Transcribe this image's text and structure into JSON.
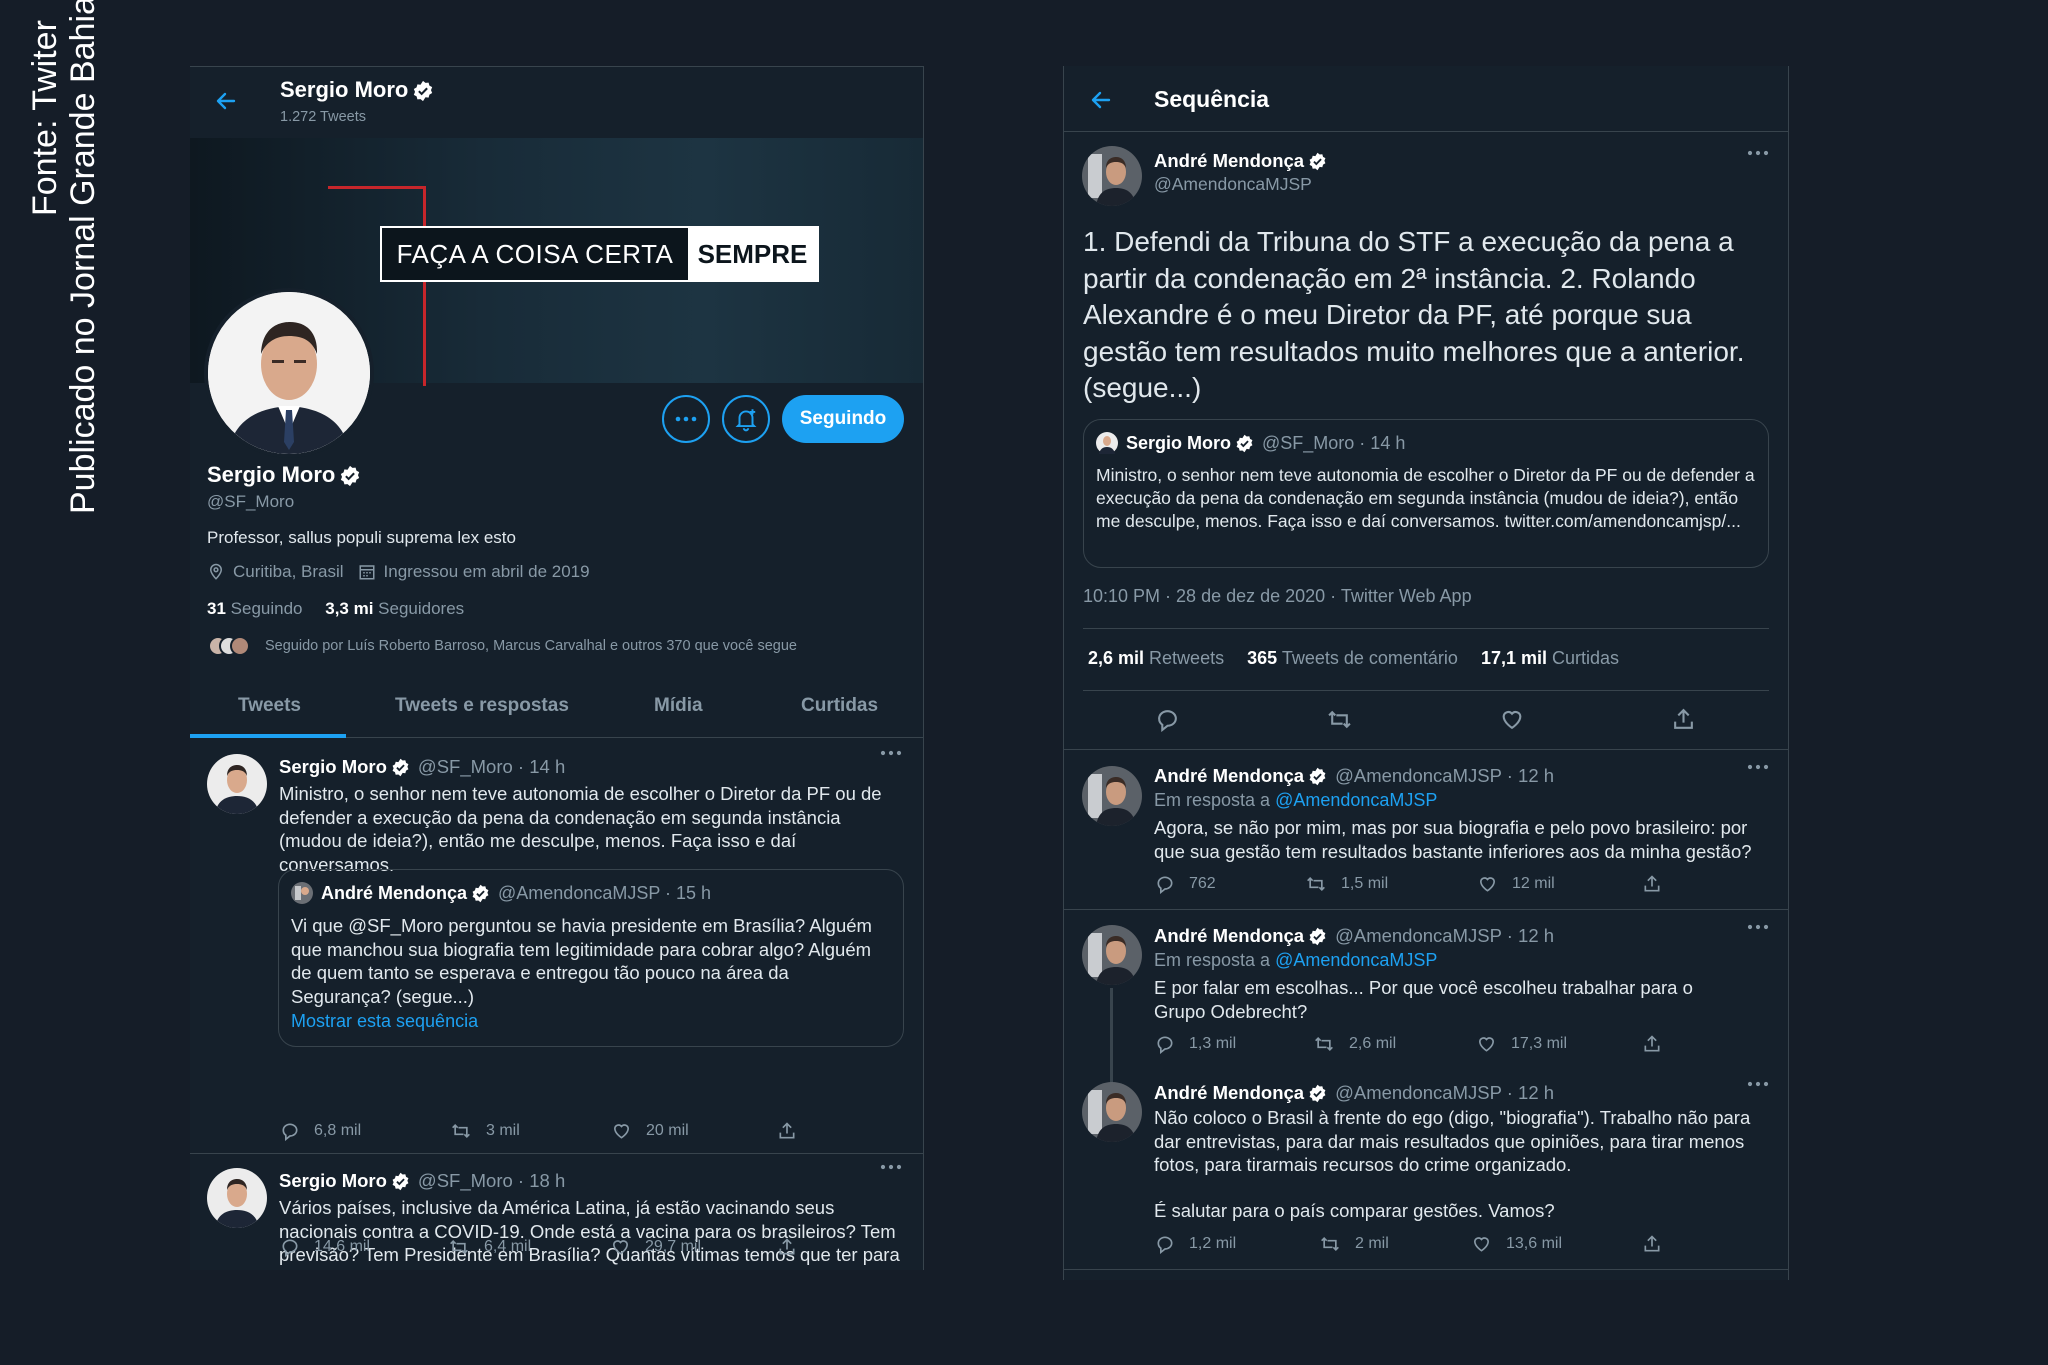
{
  "caption": {
    "line1": "Fonte: Twiter",
    "line2": "Publicado no Jornal Grande Bahia"
  },
  "profile": {
    "header_name": "Sergio Moro",
    "tweet_count": "1.272 Tweets",
    "banner_text_a": "FAÇA A COISA CERTA",
    "banner_text_b": "SEMPRE",
    "name": "Sergio Moro",
    "handle": "@SF_Moro",
    "bio": "Professor, sallus populi suprema lex esto",
    "location": "Curitiba, Brasil",
    "joined": "Ingressou em abril de 2019",
    "following_count": "31",
    "following_label": "Seguindo",
    "followers_count": "3,3 mi",
    "followers_label": "Seguidores",
    "followed_by": "Seguido por Luís Roberto Barroso, Marcus Carvalhal e outros 370 que você segue",
    "follow_button": "Seguindo",
    "tabs": [
      "Tweets",
      "Tweets e respostas",
      "Mídia",
      "Curtidas"
    ]
  },
  "left_tweets": [
    {
      "name": "Sergio Moro",
      "meta": "@SF_Moro · 14 h",
      "text": "Ministro, o senhor nem teve autonomia de escolher o Diretor da PF ou de defender a execução da pena da condenação em segunda instância (mudou de ideia?), então me desculpe, menos. Faça isso e daí conversamos.",
      "quote": {
        "name": "André Mendonça",
        "meta": "@AmendoncaMJSP · 15 h",
        "text": "Vi que @SF_Moro perguntou se havia presidente em Brasília? Alguém que manchou sua biografia tem legitimidade para cobrar algo? Alguém de quem tanto se esperava e entregou tão pouco na área da Segurança? (segue...)",
        "link": "Mostrar esta sequência"
      },
      "replies": "6,8 mil",
      "retweets": "3 mil",
      "likes": "20 mil"
    },
    {
      "name": "Sergio Moro",
      "meta": "@SF_Moro · 18 h",
      "text": "Vários países, inclusive da América Latina, já estão vacinando seus nacionais contra a COVID-19. Onde está a vacina para os brasileiros? Tem previsão? Tem Presidente em Brasília? Quantas vítimas temos que ter para o Governo abandonar o seu negacionismo?",
      "replies": "14,6 mil",
      "retweets": "6,4 mil",
      "likes": "29,7 mil"
    }
  ],
  "thread": {
    "header": "Sequência",
    "main": {
      "name": "André Mendonça",
      "handle": "@AmendoncaMJSP",
      "text": "1. Defendi da Tribuna do STF a execução da pena a partir da condenação em 2ª instância. 2. Rolando Alexandre é o meu Diretor da PF, até porque sua gestão tem resultados muito melhores que a anterior. (segue...)",
      "quote": {
        "name": "Sergio Moro",
        "meta": "@SF_Moro · 14 h",
        "text": "Ministro, o senhor nem teve autonomia de escolher o Diretor da PF ou de defender a execução da pena da condenação em segunda instância (mudou de ideia?), então me desculpe, menos. Faça isso e daí conversamos. twitter.com/amendoncamjsp/..."
      },
      "timestamp": "10:10 PM · 28 de dez de 2020 · Twitter Web App",
      "retweets_count": "2,6 mil",
      "retweets_label": "Retweets",
      "comments_count": "365",
      "comments_label": "Tweets de comentário",
      "likes_count": "17,1 mil",
      "likes_label": "Curtidas"
    },
    "replies": [
      {
        "name": "André Mendonça",
        "meta": "@AmendoncaMJSP · 12 h",
        "reply_prefix": "Em resposta a",
        "reply_to": "@AmendoncaMJSP",
        "text": "Agora, se não por mim, mas por sua biografia e pelo povo brasileiro: por que sua gestão tem resultados bastante inferiores aos da minha gestão?",
        "replies": "762",
        "retweets": "1,5 mil",
        "likes": "12 mil"
      },
      {
        "name": "André Mendonça",
        "meta": "@AmendoncaMJSP · 12 h",
        "reply_prefix": "Em resposta a",
        "reply_to": "@AmendoncaMJSP",
        "text": "E por falar em escolhas... Por que você escolheu trabalhar para o Grupo Odebrecht?",
        "replies": "1,3 mil",
        "retweets": "2,6 mil",
        "likes": "17,3 mil"
      },
      {
        "name": "André Mendonça",
        "meta": "@AmendoncaMJSP · 12 h",
        "text": "Não coloco o Brasil à frente do ego (digo, \"biografia\"). Trabalho não para dar entrevistas, para dar mais resultados que opiniões, para tirar menos fotos, para tirarmais recursos do crime organizado.",
        "text2": "É salutar para o país comparar gestões. Vamos?",
        "replies": "1,2 mil",
        "retweets": "2 mil",
        "likes": "13,6 mil"
      }
    ]
  },
  "colors": {
    "background": "#151d28",
    "panel": "#15202b",
    "accent": "#1da1f2",
    "muted": "#8899a6",
    "border": "#38444d"
  },
  "icons": [
    "back-arrow-icon",
    "verified-badge-icon",
    "more-icon",
    "bell-plus-icon",
    "location-pin-icon",
    "calendar-icon",
    "reply-icon",
    "retweet-icon",
    "like-icon",
    "share-icon"
  ]
}
